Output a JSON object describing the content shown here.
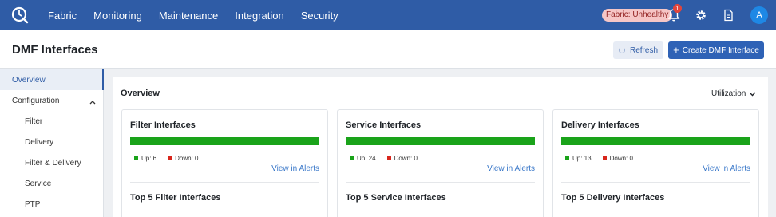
{
  "nav": {
    "items": [
      "Fabric",
      "Monitoring",
      "Maintenance",
      "Integration",
      "Security"
    ]
  },
  "status": {
    "health_label": "Fabric: Unhealthy",
    "notification_count": "1"
  },
  "user": {
    "avatar_initial": "A"
  },
  "header": {
    "title": "DMF Interfaces",
    "refresh_label": "Refresh",
    "create_label": "Create DMF Interface"
  },
  "sidebar": {
    "items": [
      {
        "label": "Overview"
      },
      {
        "label": "Configuration"
      },
      {
        "label": "Filter"
      },
      {
        "label": "Delivery"
      },
      {
        "label": "Filter & Delivery"
      },
      {
        "label": "Service"
      },
      {
        "label": "PTP"
      }
    ]
  },
  "main": {
    "title": "Overview",
    "selector_label": "Utilization",
    "cards": [
      {
        "title": "Filter Interfaces",
        "up": "Up: 6",
        "down": "Down: 0",
        "up_fraction": 1.0,
        "link": "View in Alerts",
        "top5": "Top 5 Filter Interfaces"
      },
      {
        "title": "Service Interfaces",
        "up": "Up: 24",
        "down": "Down: 0",
        "up_fraction": 1.0,
        "link": "View in Alerts",
        "top5": "Top 5 Service Interfaces"
      },
      {
        "title": "Delivery Interfaces",
        "up": "Up: 13",
        "down": "Down: 0",
        "up_fraction": 1.0,
        "link": "View in Alerts",
        "top5": "Top 5 Delivery Interfaces"
      }
    ]
  },
  "colors": {
    "topbar": "#2f5ca6",
    "up": "#1aa31a",
    "down": "#d8261c",
    "link": "#3a78c9"
  }
}
